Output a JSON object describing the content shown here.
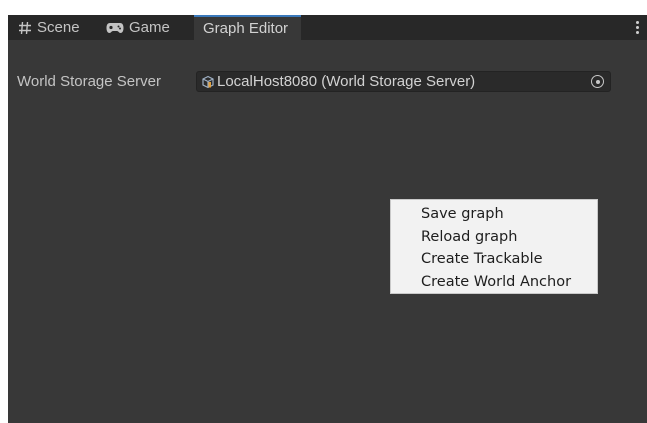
{
  "tabs": [
    {
      "label": "Scene",
      "icon": "hash-icon"
    },
    {
      "label": "Game",
      "icon": "gamepad-icon"
    },
    {
      "label": "Graph Editor",
      "active": true
    }
  ],
  "tab_menu_icon": "kebab-menu-icon",
  "graph_editor": {
    "world_storage_label": "World Storage Server",
    "world_storage_value": "LocalHost8080 (World Storage Server)",
    "object_icon": "scriptable-object-icon",
    "picker_icon": "object-picker-icon"
  },
  "context_menu": {
    "items": [
      "Save graph",
      "Reload graph",
      "Create Trackable",
      "Create World Anchor"
    ]
  },
  "colors": {
    "panel_bg": "#383838",
    "tabbar_bg": "#282828",
    "active_tab_accent": "#3a79bb",
    "menu_bg": "#f2f2f2"
  }
}
